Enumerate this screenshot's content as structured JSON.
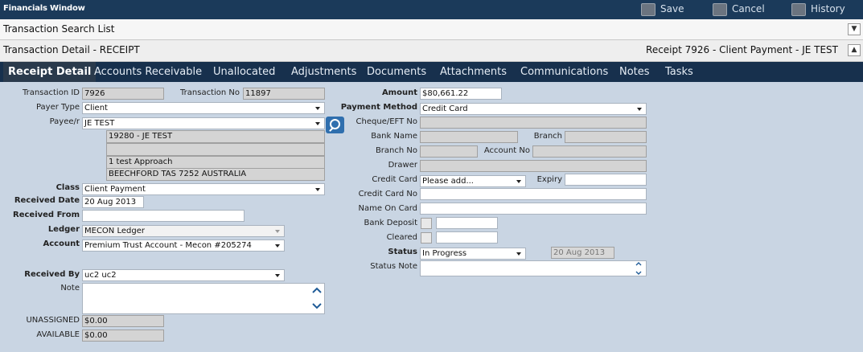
{
  "window": {
    "title": "Financials Window",
    "buttons": {
      "save": "Save",
      "cancel": "Cancel",
      "history": "History"
    }
  },
  "search_bar": {
    "label": "Transaction Search List"
  },
  "detail_bar": {
    "label": "Transaction Detail - RECEIPT",
    "right": "Receipt 7926 - Client Payment - JE TEST"
  },
  "tabs": [
    "Receipt Detail",
    "Accounts Receivable",
    "Unallocated",
    "Adjustments",
    "Documents",
    "Attachments",
    "Communications",
    "Notes",
    "Tasks"
  ],
  "left": {
    "transaction_id_label": "Transaction ID",
    "transaction_id": "7926",
    "transaction_no_label": "Transaction No",
    "transaction_no": "11897",
    "payer_type_label": "Payer Type",
    "payer_type": "Client",
    "payee_label": "Payee/r",
    "payee": "JE TEST",
    "address": [
      "19280 - JE TEST",
      "",
      "1 test Approach",
      "BEECHFORD TAS 7252 AUSTRALIA"
    ],
    "class_label": "Class",
    "class": "Client Payment",
    "received_date_label": "Received Date",
    "received_date": "20 Aug 2013",
    "received_from_label": "Received From",
    "received_from": "",
    "ledger_label": "Ledger",
    "ledger": "MECON Ledger",
    "account_label": "Account",
    "account": "Premium Trust Account - Mecon #205274",
    "received_by_label": "Received By",
    "received_by": "uc2 uc2",
    "note_label": "Note",
    "note": "",
    "unassigned_label": "UNASSIGNED",
    "unassigned": "$0.00",
    "available_label": "AVAILABLE",
    "available": "$0.00"
  },
  "right": {
    "amount_label": "Amount",
    "amount": "$80,661.22",
    "payment_method_label": "Payment Method",
    "payment_method": "Credit Card",
    "cheque_label": "Cheque/EFT No",
    "cheque": "",
    "bank_name_label": "Bank Name",
    "bank_name": "",
    "branch_label": "Branch",
    "branch": "",
    "branch_no_label": "Branch No",
    "branch_no": "",
    "account_no_label": "Account No",
    "account_no": "",
    "drawer_label": "Drawer",
    "drawer": "",
    "credit_card_label": "Credit Card",
    "credit_card": "Please add...",
    "expiry_label": "Expiry",
    "expiry": "",
    "credit_card_no_label": "Credit Card No",
    "credit_card_no": "",
    "name_on_card_label": "Name On Card",
    "name_on_card": "",
    "bank_deposit_label": "Bank Deposit",
    "bank_deposit": "",
    "cleared_label": "Cleared",
    "cleared": "",
    "status_label": "Status",
    "status": "In Progress",
    "status_date": "20 Aug 2013",
    "status_note_label": "Status Note",
    "status_note": ""
  }
}
